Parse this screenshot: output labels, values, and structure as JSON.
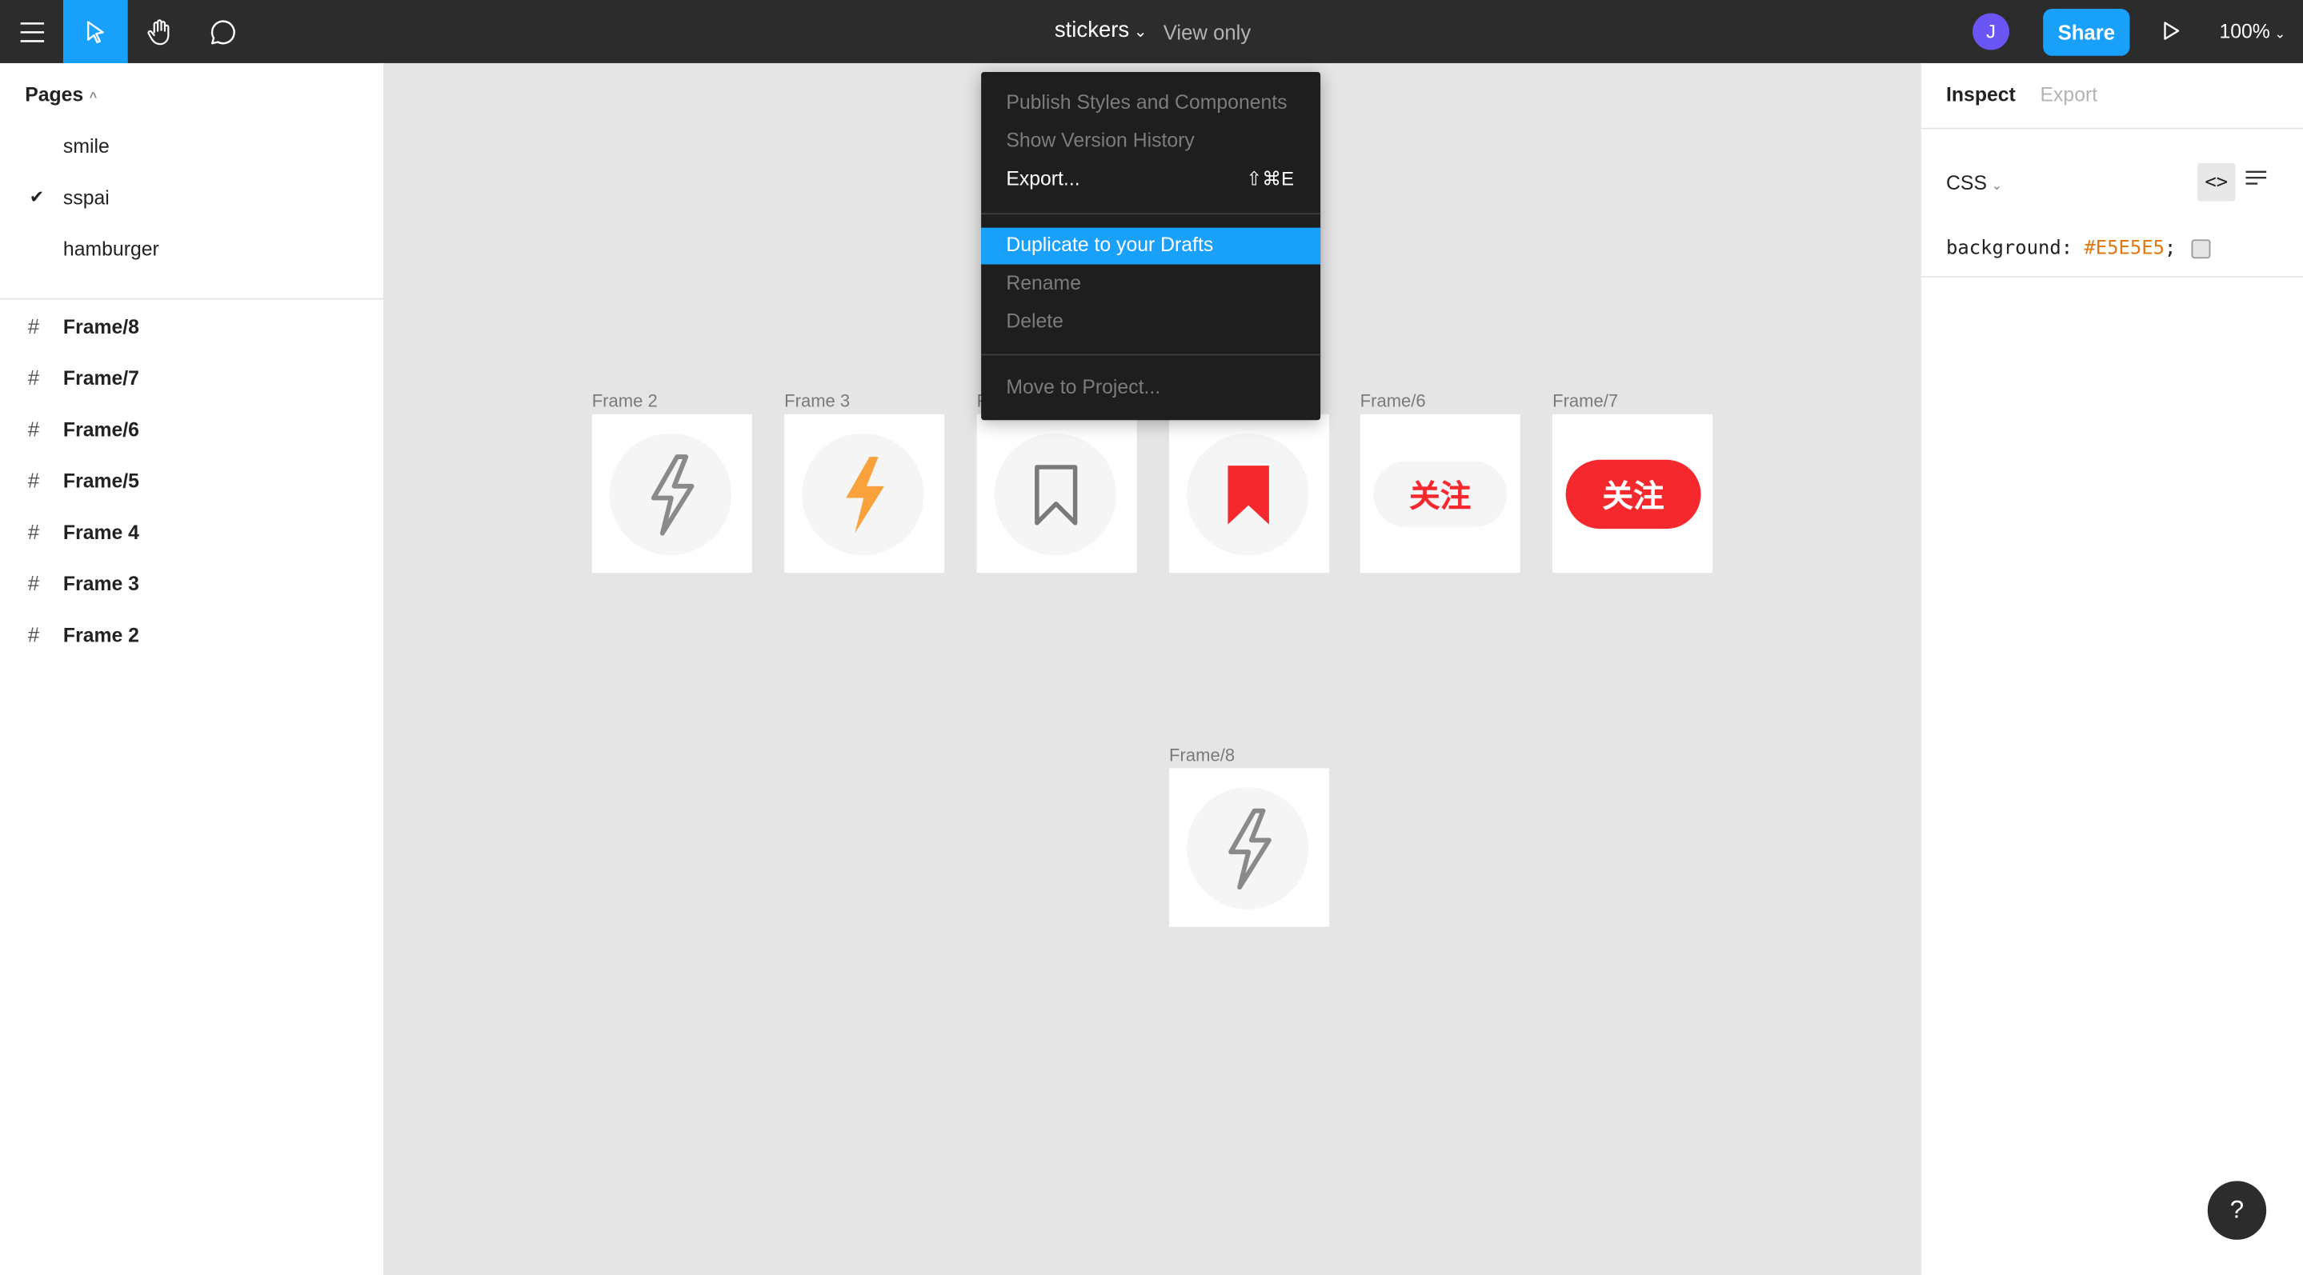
{
  "toolbar": {
    "file_name": "stickers",
    "view_mode": "View only",
    "user_initial": "J",
    "share_label": "Share",
    "zoom": "100%"
  },
  "pages": {
    "header": "Pages",
    "items": [
      {
        "label": "smile",
        "selected": false
      },
      {
        "label": "sspai",
        "selected": true
      },
      {
        "label": "hamburger",
        "selected": false
      }
    ]
  },
  "layers": [
    "Frame/8",
    "Frame/7",
    "Frame/6",
    "Frame/5",
    "Frame 4",
    "Frame 3",
    "Frame 2"
  ],
  "canvas": {
    "frames": [
      {
        "label": "Frame 2",
        "content": "bolt-outline-icon"
      },
      {
        "label": "Frame 3",
        "content": "bolt-filled-icon"
      },
      {
        "label": "F",
        "content": "bookmark-outline-icon"
      },
      {
        "label": "",
        "content": "bookmark-filled-icon"
      },
      {
        "label": "Frame/6",
        "content": "follow-pill-light",
        "text": "关注"
      },
      {
        "label": "Frame/7",
        "content": "follow-pill-red",
        "text": "关注"
      },
      {
        "label": "Frame/8",
        "content": "bolt-outline-icon"
      }
    ]
  },
  "context_menu": {
    "items": [
      {
        "label": "Publish Styles and Components",
        "disabled": true
      },
      {
        "label": "Show Version History",
        "disabled": true
      },
      {
        "label": "Export...",
        "shortcut": "⇧⌘E",
        "disabled": false
      },
      {
        "label": "Duplicate to your Drafts",
        "highlighted": true
      },
      {
        "label": "Rename",
        "disabled": true
      },
      {
        "label": "Delete",
        "disabled": true
      },
      {
        "label": "Move to Project...",
        "disabled": true
      }
    ]
  },
  "inspect": {
    "tab_inspect": "Inspect",
    "tab_export": "Export",
    "language": "CSS",
    "code_property": "background:",
    "code_value": "#E5E5E5",
    "code_end": ";"
  },
  "help_label": "?",
  "colors": {
    "accent": "#18a0fb",
    "toolbar": "#2c2c2c",
    "canvas": "#e5e5e5",
    "bolt_orange": "#f9a23c",
    "red": "#f5282d"
  }
}
